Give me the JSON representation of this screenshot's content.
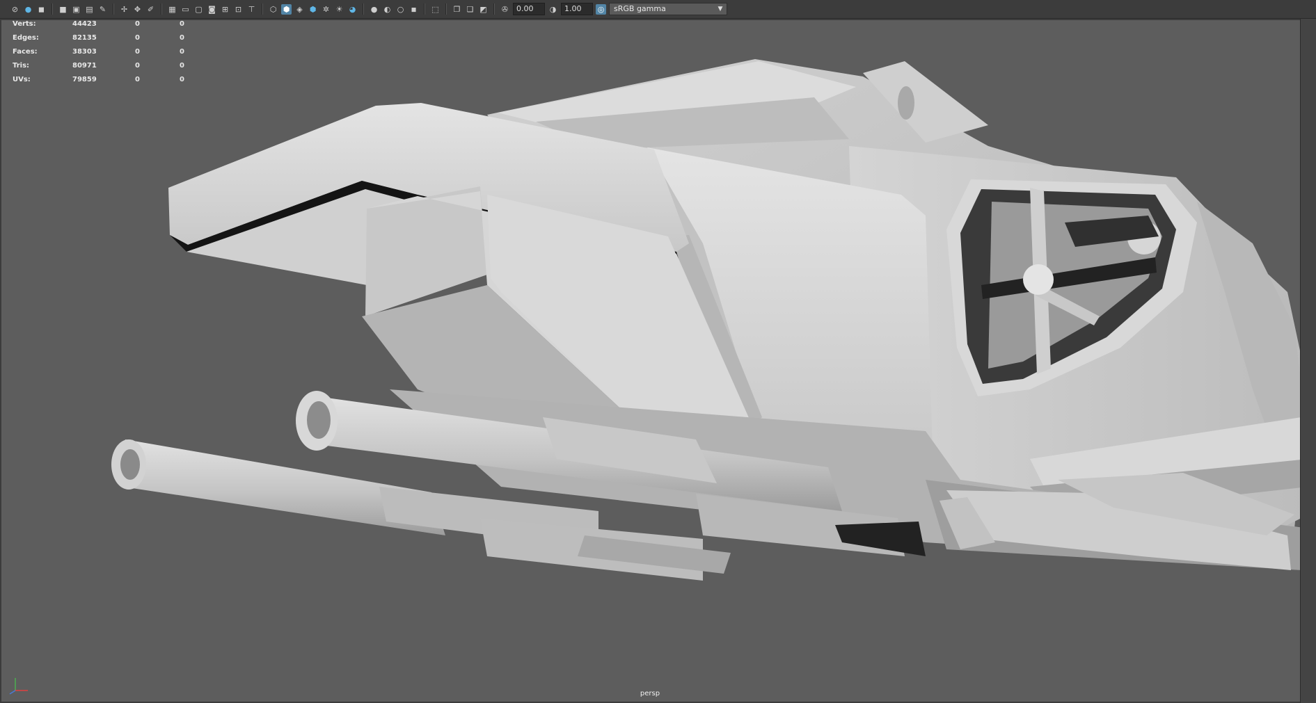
{
  "toolbar": {
    "exposure_value": "0.00",
    "gamma_value": "1.00",
    "color_space": "sRGB gamma"
  },
  "stats": [
    {
      "label": "Verts:",
      "value": "44423",
      "sel": "0",
      "sel2": "0"
    },
    {
      "label": "Edges:",
      "value": "82135",
      "sel": "0",
      "sel2": "0"
    },
    {
      "label": "Faces:",
      "value": "38303",
      "sel": "0",
      "sel2": "0"
    },
    {
      "label": "Tris:",
      "value": "80971",
      "sel": "0",
      "sel2": "0"
    },
    {
      "label": "UVs:",
      "value": "79859",
      "sel": "0",
      "sel2": "0"
    }
  ],
  "viewport": {
    "camera": "persp"
  },
  "colors": {
    "viewport_bg": "#5d5d5d",
    "toolbar_bg": "#3c3c3c",
    "active_blue": "#5285a6"
  }
}
